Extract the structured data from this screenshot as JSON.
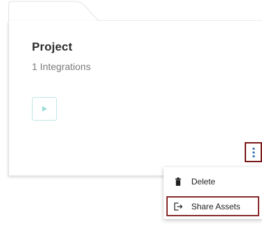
{
  "card": {
    "title": "Project",
    "subtitle": "1 Integrations",
    "play_icon": "play-icon",
    "more_icon": "more-vertical-icon"
  },
  "menu": {
    "items": [
      {
        "label": "Delete",
        "icon": "trash-icon"
      },
      {
        "label": "Share Assets",
        "icon": "share-exit-icon"
      }
    ]
  },
  "colors": {
    "accent_teal": "#4cc5c1",
    "highlight_border": "#7a1616",
    "dots_blue": "#2f6fb0"
  }
}
